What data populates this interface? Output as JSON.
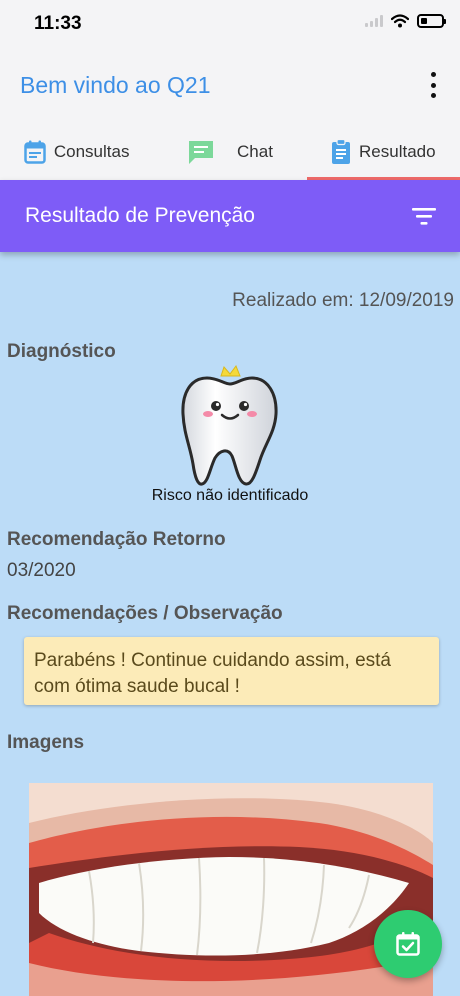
{
  "status_bar": {
    "time": "11:33"
  },
  "app_bar": {
    "title": "Bem vindo ao Q21",
    "menu_icon": "more-vertical-icon"
  },
  "tabs": [
    {
      "label": "Consultas",
      "icon": "calendar-icon",
      "active": false
    },
    {
      "label": "Chat",
      "icon": "chat-icon",
      "active": false
    },
    {
      "label": "Resultado",
      "icon": "clipboard-icon",
      "active": true
    }
  ],
  "toolbar": {
    "title": "Resultado de Prevenção",
    "filter_icon": "filter-icon"
  },
  "content": {
    "performed_on": "Realizado em: 12/09/2019",
    "diagnosis_label": "Diagnóstico",
    "risk_text": "Risco não identificado",
    "return_label": "Recomendação Retorno",
    "return_value": "03/2020",
    "observations_label": "Recomendações / Observação",
    "observation_text": "Parabéns ! Continue cuidando assim, está com ótima saude bucal !",
    "images_label": "Imagens"
  },
  "fab": {
    "icon": "calendar-check-icon"
  },
  "colors": {
    "background": "#bcdcf7",
    "toolbar": "#7e5cf7",
    "app_title": "#3d8fe6",
    "tab_indicator": "#ef6a6a",
    "note": "#fcebb8",
    "fab": "#2ecc71"
  }
}
